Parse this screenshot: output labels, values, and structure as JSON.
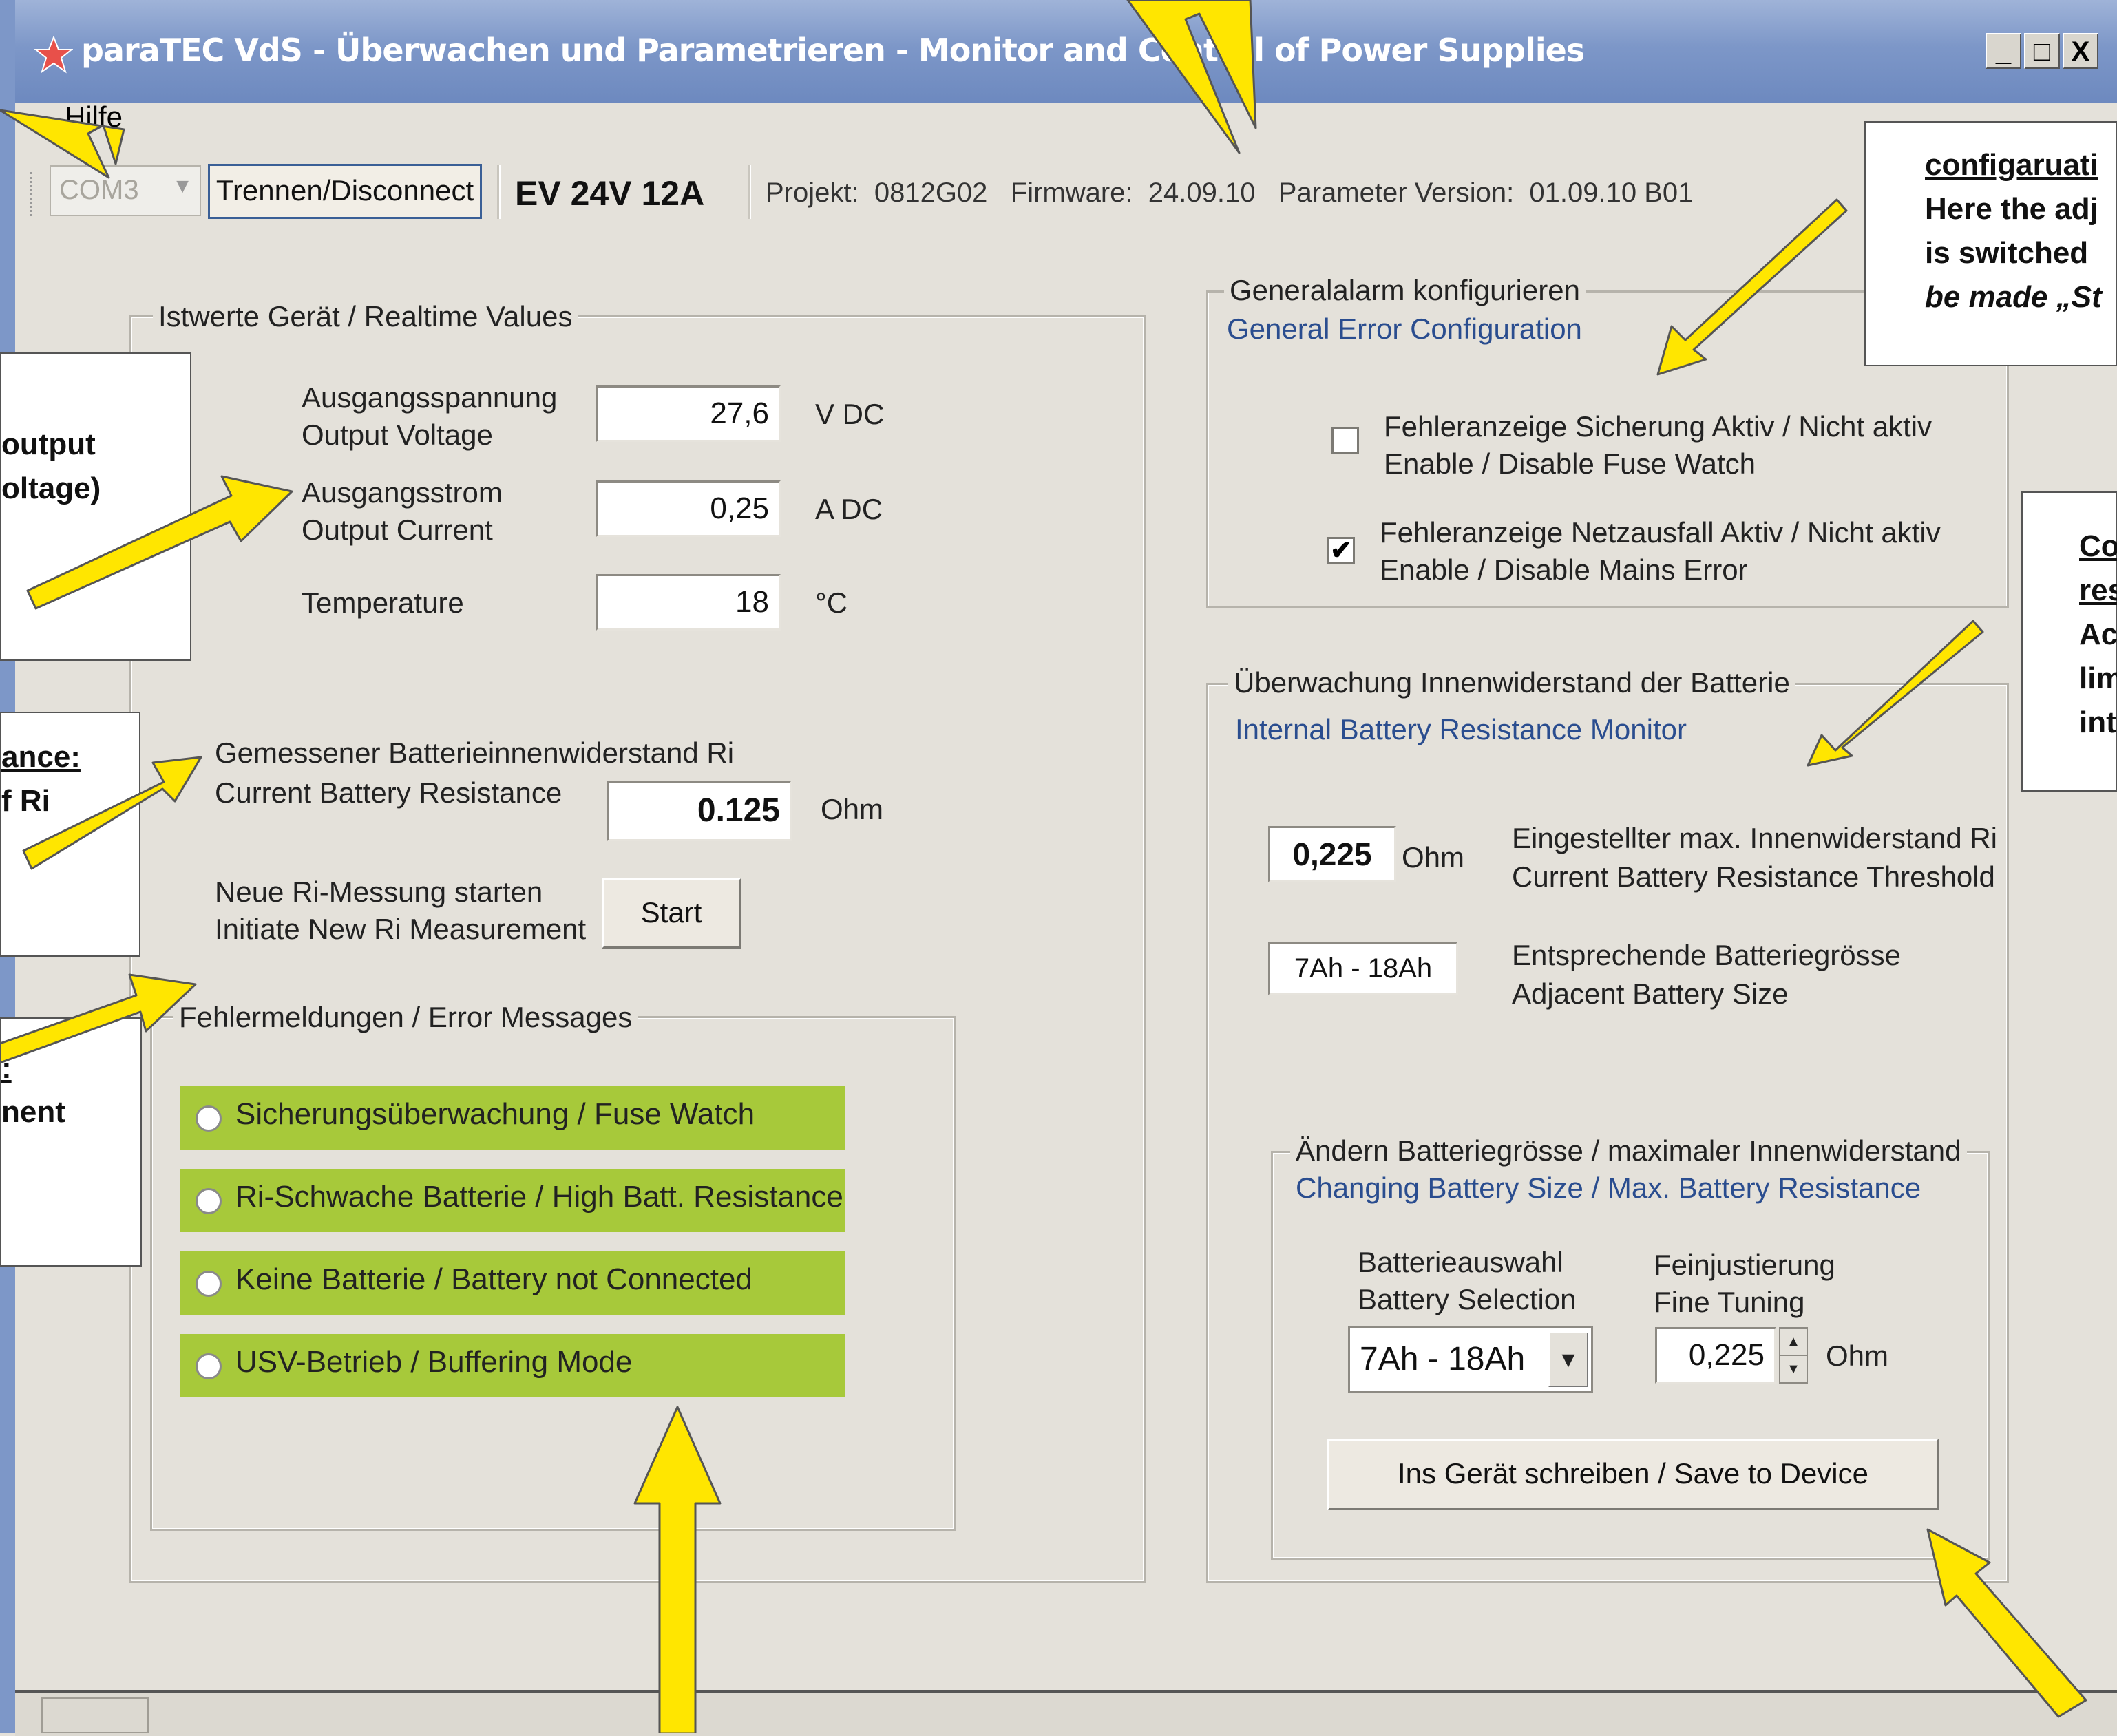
{
  "window": {
    "title": "paraTEC VdS - Überwachen und Parametrieren  - Monitor and Control of Power Supplies",
    "controls": [
      "_",
      "□",
      "X"
    ]
  },
  "menu": {
    "help": "Hilfe"
  },
  "toolbar": {
    "port": "COM3",
    "disconnect_label": "Trennen/Disconnect",
    "model": "EV 24V 12A",
    "info": "Projekt:  0812G02   Firmware:  24.09.10   Parameter Version:  01.09.10 B01"
  },
  "realtime": {
    "legend": "Istwerte Gerät / Realtime Values",
    "voltage_label_de": "Ausgangsspannung",
    "voltage_label_en": "Output Voltage",
    "voltage_value": "27,6",
    "voltage_unit": "V DC",
    "current_label_de": "Ausgangsstrom",
    "current_label_en": "Output Current",
    "current_value": "0,25",
    "current_unit": "A DC",
    "temp_label": "Temperature",
    "temp_value": "18",
    "temp_unit": "°C",
    "ri_label_de": "Gemessener Batterieinnenwiderstand Ri",
    "ri_label_en": "Current Battery Resistance",
    "ri_value": "0.125",
    "ri_unit": "Ohm",
    "new_ri_de": "Neue Ri-Messung starten",
    "new_ri_en": "Initiate New Ri Measurement",
    "start_label": "Start"
  },
  "errors": {
    "legend": "Fehlermeldungen / Error Messages",
    "items": [
      "Sicherungsüberwachung / Fuse Watch",
      "Ri-Schwache Batterie / High Batt. Resistance",
      "Keine Batterie / Battery not Connected",
      "USV-Betrieb / Buffering Mode"
    ],
    "highlight_color": "#a7c93a"
  },
  "general_alarm": {
    "legend": "Generalalarm konfigurieren",
    "subtitle": "General Error Configuration",
    "fuse_de": "Fehleranzeige Sicherung Aktiv / Nicht aktiv",
    "fuse_en": "Enable / Disable Fuse Watch",
    "fuse_checked": false,
    "mains_de": "Fehleranzeige Netzausfall Aktiv / Nicht aktiv",
    "mains_en": "Enable / Disable Mains Error",
    "mains_checked": true
  },
  "battery_monitor": {
    "legend": "Überwachung Innenwiderstand der Batterie",
    "subtitle": "Internal Battery Resistance Monitor",
    "threshold_value": "0,225",
    "threshold_unit": "Ohm",
    "threshold_de": "Eingestellter max. Innenwiderstand Ri",
    "threshold_en": "Current Battery Resistance Threshold",
    "size_value": "7Ah - 18Ah",
    "size_de": "Entsprechende Batteriegrösse",
    "size_en": "Adjacent Battery Size",
    "change": {
      "legend": "Ändern Batteriegrösse / maximaler Innenwiderstand",
      "subtitle": "Changing Battery Size / Max. Battery Resistance",
      "selection_de": "Batterieauswahl",
      "selection_en": "Battery Selection",
      "selection_value": "7Ah - 18Ah",
      "fine_de": "Feinjustierung",
      "fine_en": "Fine Tuning",
      "fine_value": "0,225",
      "fine_unit": "Ohm",
      "save_label": "Ins Gerät schreiben / Save to Device"
    }
  },
  "callouts": {
    "output": [
      "output",
      "oltage)"
    ],
    "resistance": [
      "ance:",
      "f Ri"
    ],
    "measurement": [
      ":",
      "nent"
    ],
    "config": [
      "configaruati",
      "Here the adj",
      "is switched",
      "be made „St"
    ],
    "con": [
      "Con",
      "resi",
      "Actu",
      "limit",
      "inter"
    ]
  },
  "annotation_color": "#ffe600"
}
